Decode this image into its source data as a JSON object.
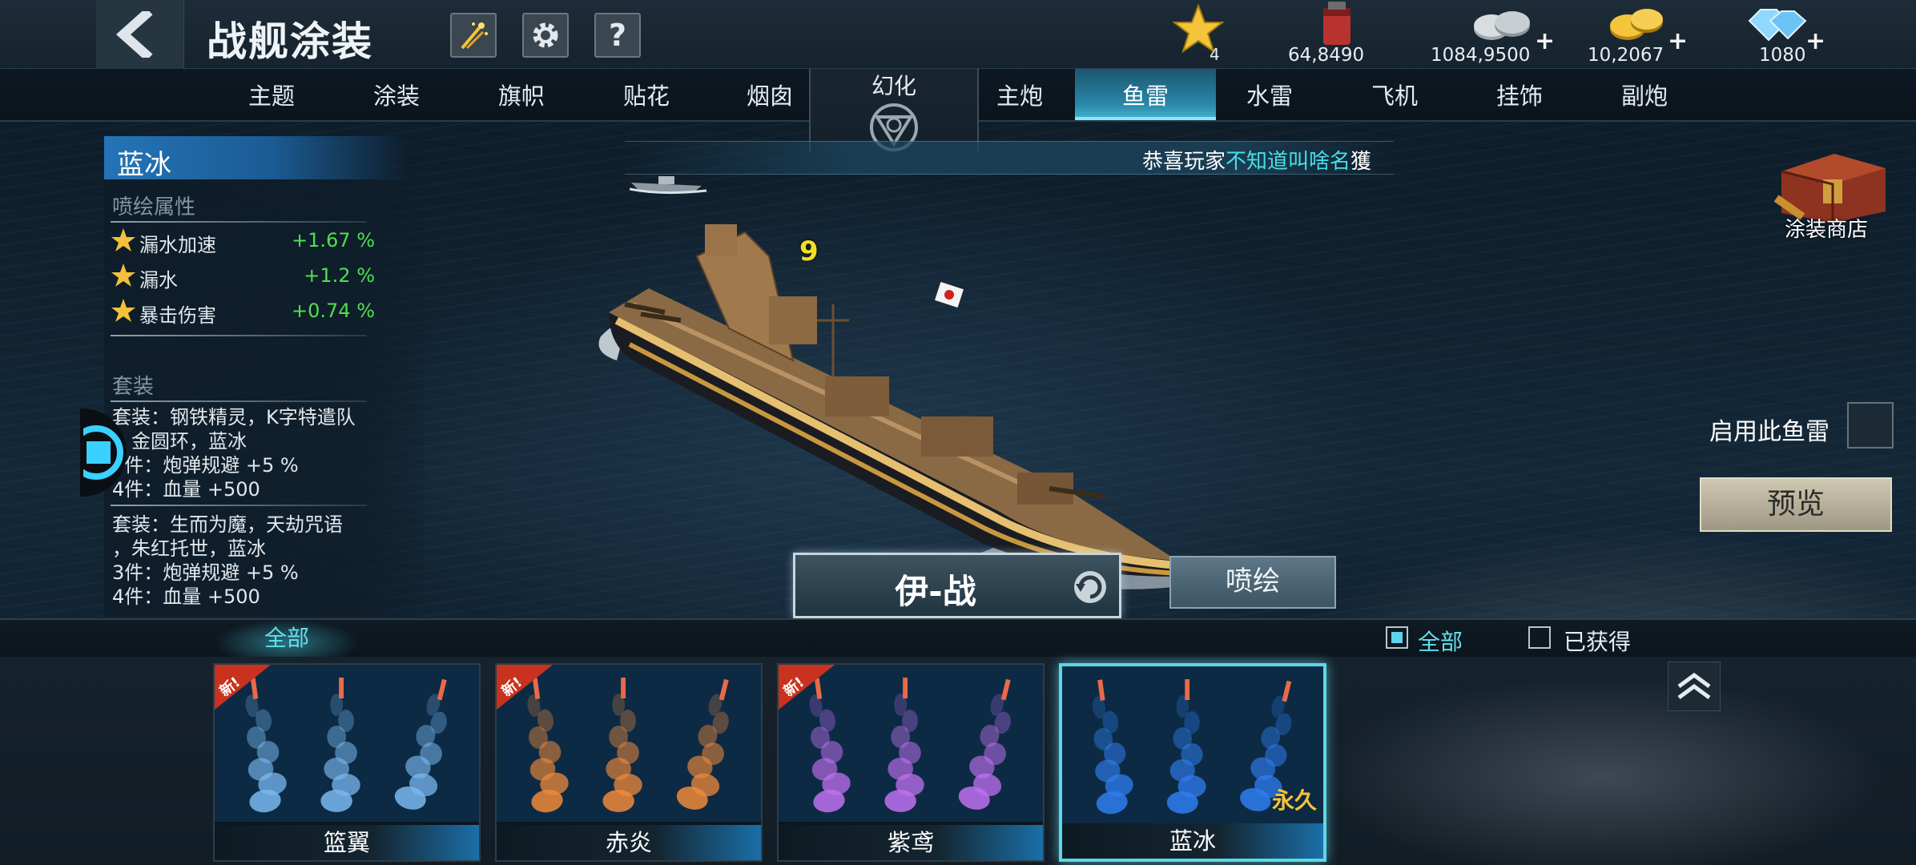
{
  "header": {
    "title": "战舰涂装",
    "resources": [
      {
        "icon": "star-rank-icon",
        "value": "4"
      },
      {
        "icon": "paint-bucket-icon",
        "value": "64,8490"
      },
      {
        "icon": "silver-coin-icon",
        "value": "1084,9500",
        "plus": "+"
      },
      {
        "icon": "gold-coin-icon",
        "value": "10,2067",
        "plus": "+"
      },
      {
        "icon": "diamond-icon",
        "value": "1080",
        "plus": "+"
      }
    ]
  },
  "tabs": {
    "left": [
      "主题",
      "涂装",
      "旗帜",
      "贴花",
      "烟囱"
    ],
    "center": "幻化",
    "right": [
      "主炮",
      "鱼雷",
      "水雷",
      "飞机",
      "挂饰",
      "副炮"
    ],
    "active": "鱼雷"
  },
  "info": {
    "skin_name": "蓝冰",
    "attr_head": "喷绘属性",
    "attributes": [
      {
        "name": "漏水加速",
        "value": "+1.67 %"
      },
      {
        "name": "漏水",
        "value": "+1.2 %"
      },
      {
        "name": "暴击伤害",
        "value": "+0.74 %"
      }
    ],
    "set_head": "套装",
    "sets": [
      [
        "套装：钢铁精灵，K字特遣队",
        "，金圆环，蓝冰",
        "3件：炮弹规避 +5 %",
        "4件：血量 +500"
      ],
      [
        "套装：生而为魔，天劫咒语",
        "，朱红托世，蓝冰",
        "3件：炮弹规避 +5 %",
        "4件：血量 +500"
      ]
    ]
  },
  "announcement": {
    "prefix": "恭喜玩家",
    "player": "不知道叫啥名",
    "tail": "獲"
  },
  "ship": {
    "name": "伊-战",
    "spray_label": "喷绘"
  },
  "right": {
    "shop_label": "涂装商店",
    "enable_label": "启用此鱼雷",
    "preview_label": "预览"
  },
  "filter": {
    "tab_all": "全部",
    "check_all": "全部",
    "check_owned": "已获得"
  },
  "cards": [
    {
      "name": "篮翼",
      "new": "新!",
      "color": "#7ab8f0",
      "selected": false,
      "perm": ""
    },
    {
      "name": "赤炎",
      "new": "新!",
      "color": "#f08a3a",
      "selected": false,
      "perm": ""
    },
    {
      "name": "紫鸢",
      "new": "新!",
      "color": "#c070f0",
      "selected": false,
      "perm": ""
    },
    {
      "name": "蓝冰",
      "new": "",
      "color": "#2f7ef0",
      "selected": true,
      "perm": "永久"
    }
  ],
  "colors": {
    "accent": "#5fd6e6",
    "positive": "#4ee04e",
    "gold": "#f4c23a"
  }
}
